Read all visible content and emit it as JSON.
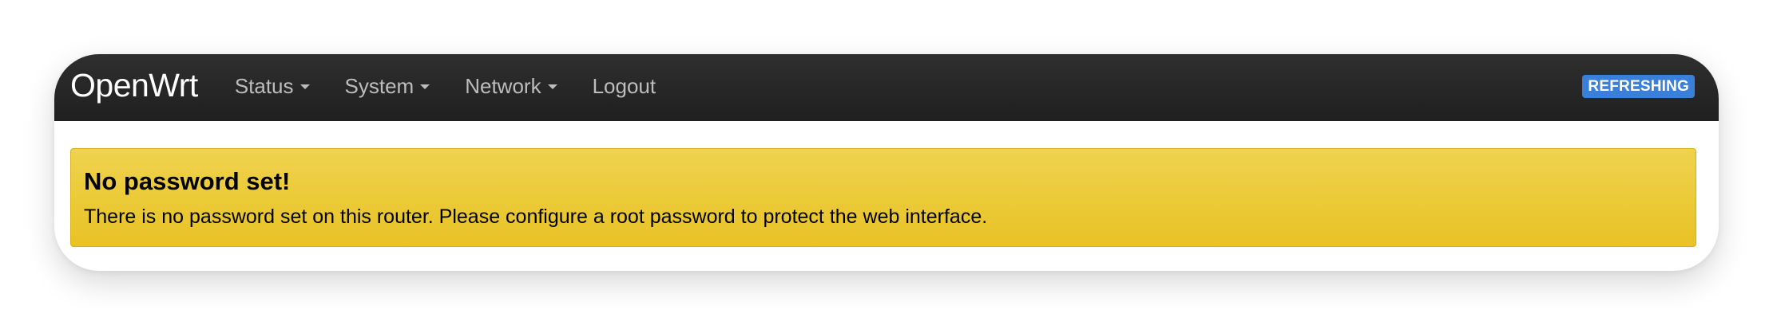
{
  "app": {
    "brand": "OpenWrt"
  },
  "nav": {
    "items": [
      {
        "label": "Status",
        "has_dropdown": true
      },
      {
        "label": "System",
        "has_dropdown": true
      },
      {
        "label": "Network",
        "has_dropdown": true
      },
      {
        "label": "Logout",
        "has_dropdown": false
      }
    ]
  },
  "indicator": {
    "label": "REFRESHING",
    "color": "#3a80d8"
  },
  "alert": {
    "title": "No password set!",
    "message": "There is no password set on this router. Please configure a root password to protect the web interface.",
    "color": "#e8c325"
  },
  "colors": {
    "navbar": "#222222",
    "nav_text": "#bdbdbd",
    "brand_text": "#ffffff"
  }
}
